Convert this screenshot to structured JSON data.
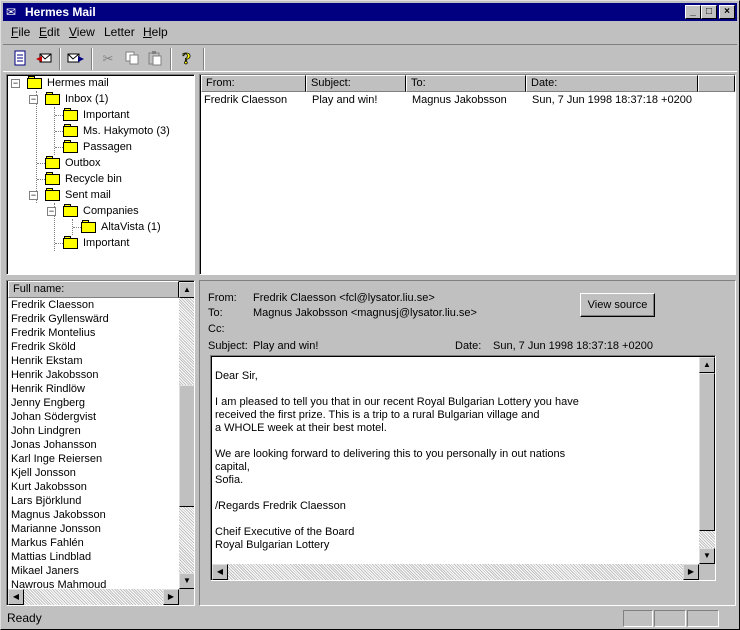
{
  "window": {
    "title": "Hermes Mail"
  },
  "menu": [
    {
      "label": "File",
      "key": "F",
      "rest": "ile"
    },
    {
      "label": "Edit",
      "key": "E",
      "rest": "dit"
    },
    {
      "label": "View",
      "key": "V",
      "rest": "iew"
    },
    {
      "label": "Letter",
      "key": "",
      "rest": "Letter"
    },
    {
      "label": "Help",
      "key": "H",
      "rest": "elp"
    }
  ],
  "toolbar": {
    "icons": [
      "new-letter-icon",
      "reply-icon",
      "forward-icon",
      "cut-icon",
      "copy-icon",
      "paste-icon",
      "help-icon"
    ]
  },
  "folders": [
    {
      "label": "Hermes mail",
      "depth": 0
    },
    {
      "label": "Inbox (1)",
      "depth": 1
    },
    {
      "label": "Important",
      "depth": 2
    },
    {
      "label": "Ms. Hakymoto (3)",
      "depth": 2
    },
    {
      "label": "Passagen",
      "depth": 2
    },
    {
      "label": "Outbox",
      "depth": 1
    },
    {
      "label": "Recycle bin",
      "depth": 1
    },
    {
      "label": "Sent mail",
      "depth": 1
    },
    {
      "label": "Companies",
      "depth": 2
    },
    {
      "label": "AltaVista (1)",
      "depth": 3
    },
    {
      "label": "Important",
      "depth": 2
    }
  ],
  "message_list": {
    "columns": [
      "From:",
      "Subject:",
      "To:",
      "Date:"
    ],
    "rows": [
      {
        "from": "Fredrik Claesson",
        "subject": "Play and win!",
        "to": "Magnus Jakobsson",
        "date": "Sun, 7 Jun 1998 18:37:18 +0200"
      }
    ]
  },
  "contacts": {
    "header": "Full name:",
    "items": [
      "Fredrik Claesson",
      "Fredrik Gyllenswärd",
      "Fredrik Montelius",
      "Fredrik Sköld",
      "Henrik Ekstam",
      "Henrik Jakobsson",
      "Henrik Rindlöw",
      "Jenny Engberg",
      "Johan Södergvist",
      "John Lindgren",
      "Jonas Johansson",
      "Karl Inge Reiersen",
      "Kjell Jonsson",
      "Kurt Jakobsson",
      "Lars Björklund",
      "Magnus Jakobsson",
      "Marianne Jonsson",
      "Markus Fahlén",
      "Mattias Lindblad",
      "Mikael Janers",
      "Nawrous Mahmoud"
    ]
  },
  "preview": {
    "from_label": "From:",
    "from_value": "Fredrik Claesson  <fcl@lysator.liu.se>",
    "to_label": "To:",
    "to_value": "Magnus Jakobsson  <magnusj@lysator.liu.se>",
    "cc_label": "Cc:",
    "subject_label": "Subject:",
    "subject_value": "Play and win!",
    "date_label": "Date:",
    "date_value": "Sun, 7 Jun 1998 18:37:18 +0200",
    "view_source_label": "View source",
    "body_lines": [
      "Dear Sir,",
      "",
      "I am pleased to tell you that in our recent Royal Bulgarian Lottery you have",
      "received the first prize. This is a trip to a rural Bulgarian village and",
      "a WHOLE week at their best motel.",
      "",
      "We are looking forward to delivering this to you personally in out nations",
      "capital,",
      "Sofia.",
      "",
      "/Regards Fredrik Claesson",
      "",
      "Cheif Executive of the Board",
      "Royal Bulgarian Lottery"
    ]
  },
  "status": {
    "text": "Ready"
  }
}
